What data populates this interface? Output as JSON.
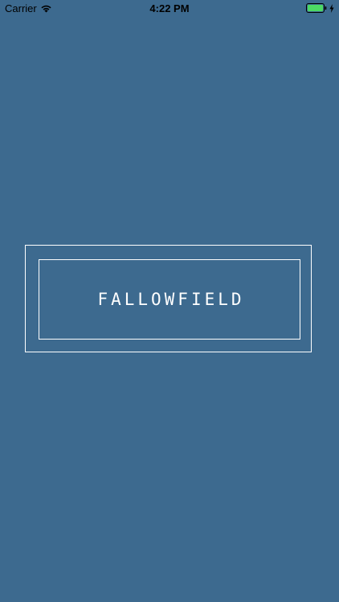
{
  "status_bar": {
    "carrier": "Carrier",
    "time": "4:22 PM",
    "battery_level": 1.0,
    "battery_color": "#4cd964",
    "icons": [
      "wifi-icon",
      "battery-icon",
      "charging-bolt-icon"
    ]
  },
  "splash": {
    "brand_name": "FALLOWFIELD",
    "background_color": "#3d6a8f",
    "frame_color": "#ffffff"
  }
}
